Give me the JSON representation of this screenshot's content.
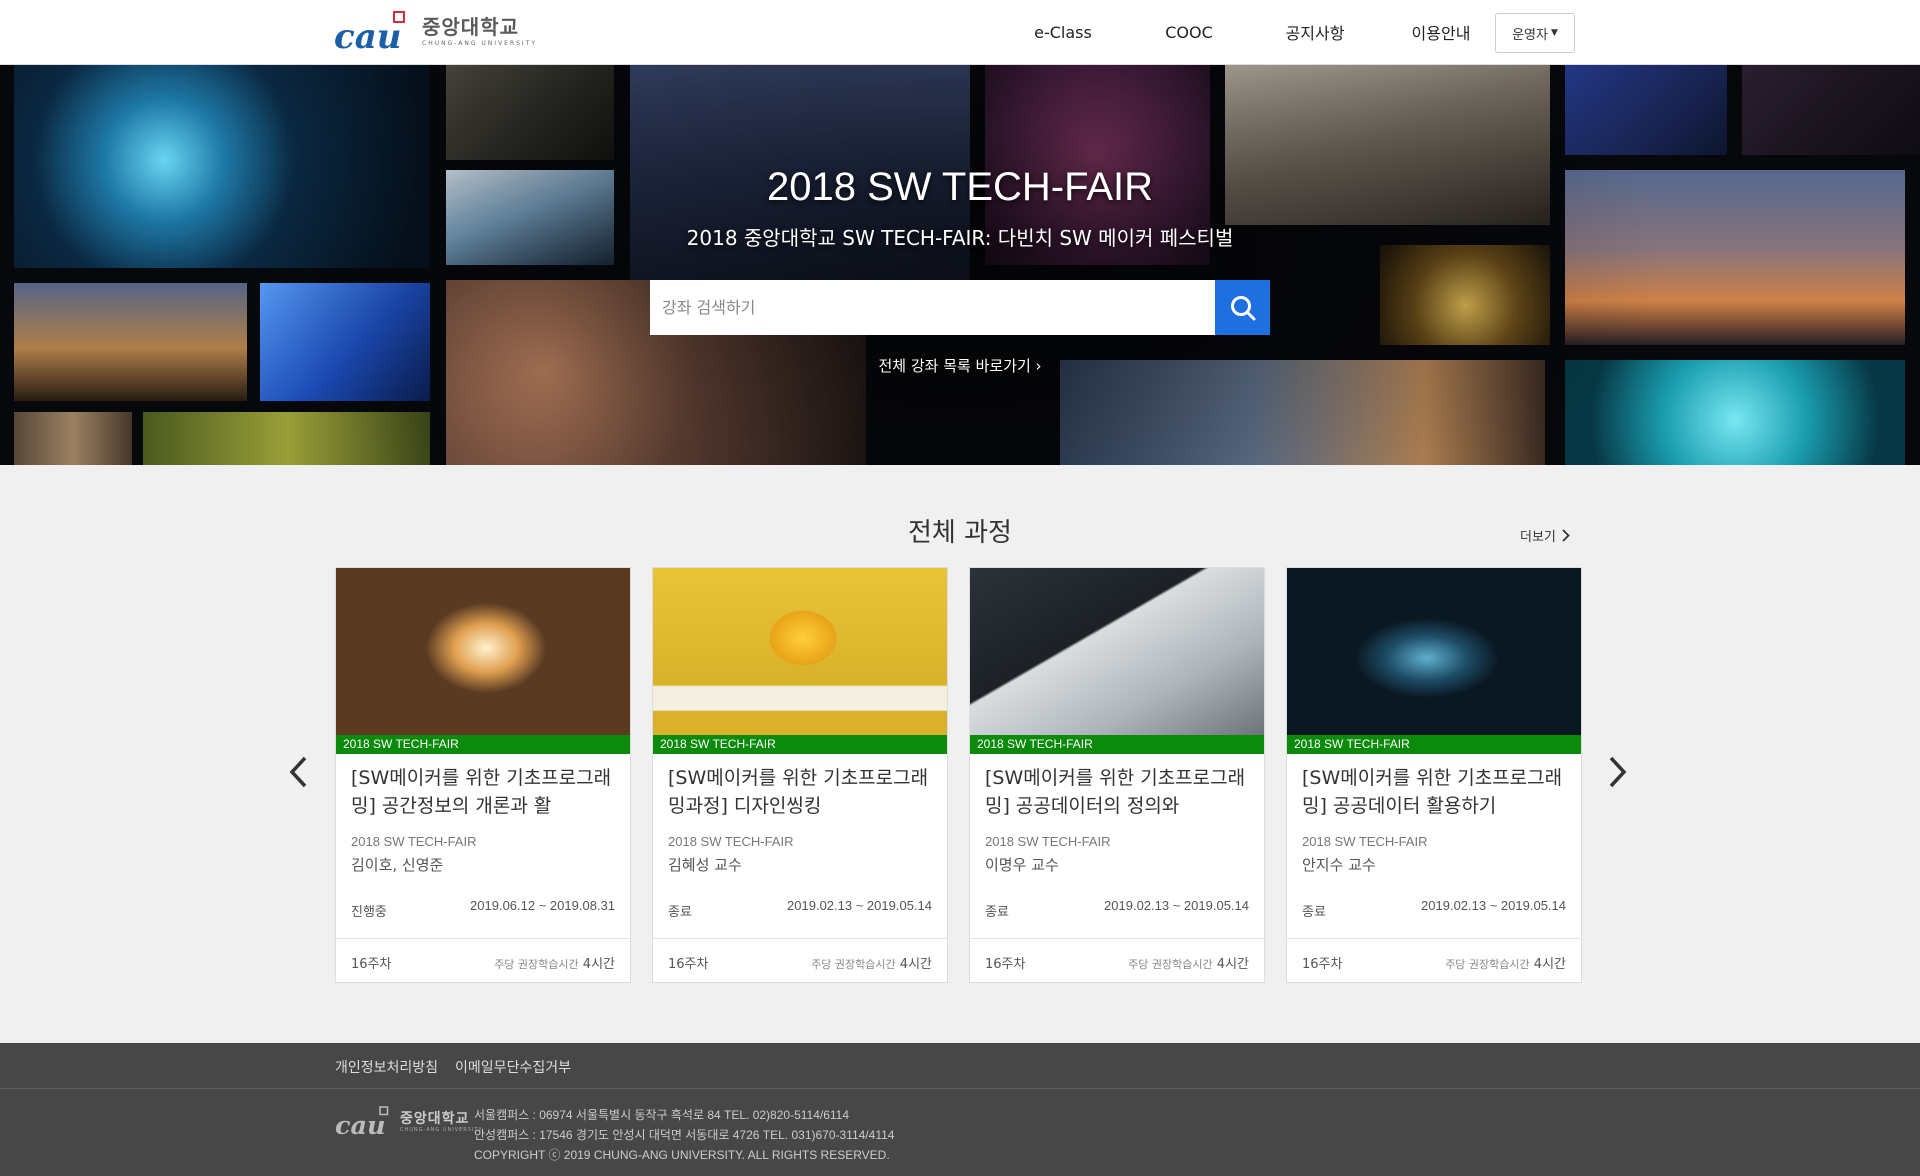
{
  "header": {
    "logo_text_ko": "중앙대학교",
    "logo_text_en": "CHUNG-ANG UNIVERSITY",
    "nav": [
      "e-Class",
      "COOC",
      "공지사항",
      "이용안내"
    ],
    "role_label": "운영자"
  },
  "hero": {
    "title": "2018 SW TECH-FAIR",
    "subtitle": "2018 중앙대학교 SW TECH-FAIR: 다빈치 SW 메이커 페스티벌",
    "search_placeholder": "강좌 검색하기",
    "all_courses_link": "전체 강좌 목록 바로가기 ›"
  },
  "courses": {
    "section_title": "전체 과정",
    "more_label": "더보기",
    "items": [
      {
        "tag": "2018 SW TECH-FAIR",
        "title": "[SW메이커를 위한 기초프로그래밍] 공간정보의 개론과 활",
        "org": "2018 SW TECH-FAIR",
        "professor": "김이호, 신영준",
        "status": "진행중",
        "period": "2019.06.12 ~ 2019.08.31",
        "weeks": "16주차",
        "hours_label": "주당 권장학습시간",
        "hours_value": "4시간"
      },
      {
        "tag": "2018 SW TECH-FAIR",
        "title": "[SW메이커를 위한 기초프로그래밍과정] 디자인씽킹",
        "org": "2018 SW TECH-FAIR",
        "professor": "김혜성 교수",
        "status": "종료",
        "period": "2019.02.13 ~ 2019.05.14",
        "weeks": "16주차",
        "hours_label": "주당 권장학습시간",
        "hours_value": "4시간"
      },
      {
        "tag": "2018 SW TECH-FAIR",
        "title": "[SW메이커를 위한 기초프로그래밍] 공공데이터의 정의와",
        "org": "2018 SW TECH-FAIR",
        "professor": "이명우 교수",
        "status": "종료",
        "period": "2019.02.13 ~ 2019.05.14",
        "weeks": "16주차",
        "hours_label": "주당 권장학습시간",
        "hours_value": "4시간"
      },
      {
        "tag": "2018 SW TECH-FAIR",
        "title": "[SW메이커를 위한 기초프로그래밍] 공공데이터 활용하기",
        "org": "2018 SW TECH-FAIR",
        "professor": "안지수 교수",
        "status": "종료",
        "period": "2019.02.13 ~ 2019.05.14",
        "weeks": "16주차",
        "hours_label": "주당 권장학습시간",
        "hours_value": "4시간"
      }
    ]
  },
  "footer": {
    "links": [
      "개인정보처리방침",
      "이메일무단수집거부"
    ],
    "seoul": "서울캠퍼스 : 06974 서울특별시 동작구 흑석로 84 TEL. 02)820-5114/6114",
    "anseong": "안성캠퍼스 : 17546 경기도 안성시 대덕면 서동대로 4726 TEL. 031)670-3114/4114",
    "copyright": "COPYRIGHT ⓒ 2019 CHUNG-ANG UNIVERSITY. ALL RIGHTS RESERVED."
  },
  "colors": {
    "accent_blue": "#1e6fe0",
    "tag_green": "#0b8a0b",
    "footer_bg": "#474747",
    "logo_blue": "#1b5fa8",
    "logo_red": "#d0303a"
  }
}
